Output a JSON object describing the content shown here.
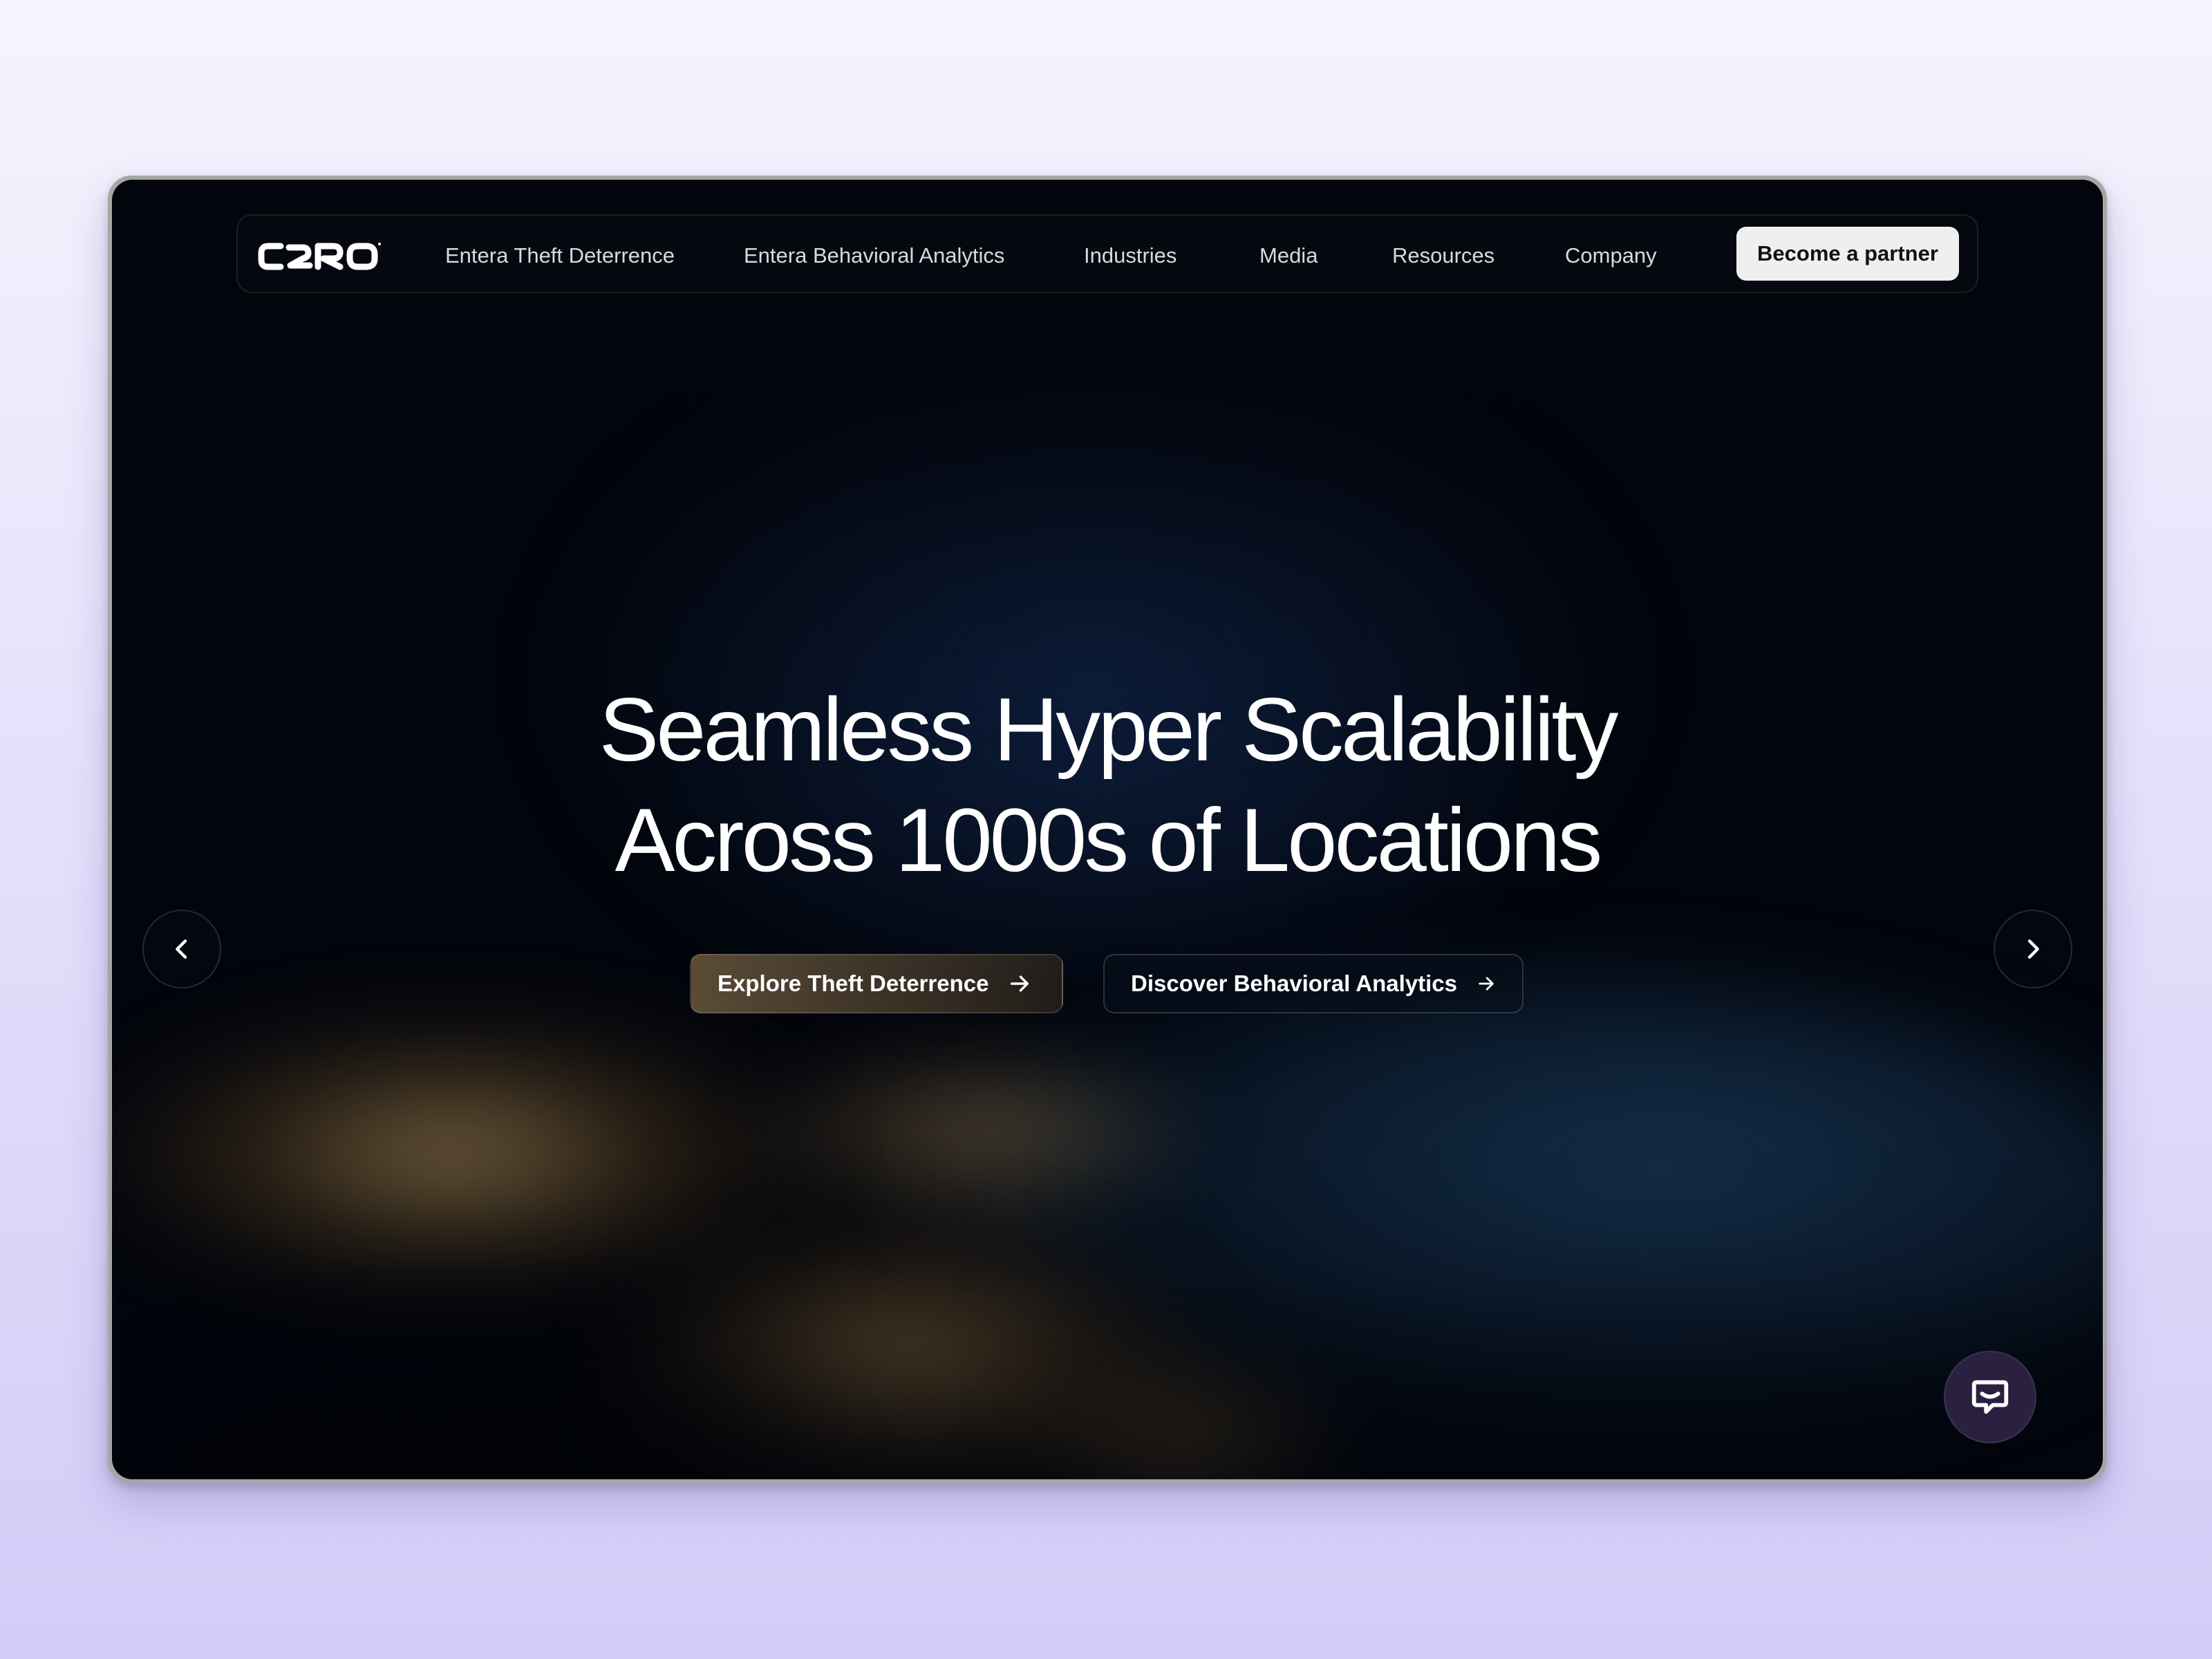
{
  "nav": {
    "logo_text": "C2RO",
    "links": [
      {
        "label": "Entera Theft Deterrence"
      },
      {
        "label": "Entera Behavioral Analytics"
      },
      {
        "label": "Industries"
      },
      {
        "label": "Media"
      },
      {
        "label": "Resources"
      },
      {
        "label": "Company"
      }
    ],
    "cta_label": "Become a partner"
  },
  "hero": {
    "headline_line1": "Seamless Hyper Scalability",
    "headline_line2": "Across 1000s of Locations",
    "buttons": [
      {
        "label": "Explore Theft Deterrence",
        "icon": "arrow-right-icon"
      },
      {
        "label": "Discover Behavioral Analytics",
        "icon": "arrow-right-icon"
      }
    ]
  },
  "carousel": {
    "prev_icon": "chevron-left-icon",
    "next_icon": "chevron-right-icon"
  },
  "chat": {
    "icon": "chat-bubble-icon"
  },
  "colors": {
    "page_background": "#e6e1fb",
    "screen_background": "#02050c",
    "partner_button": "#efefef",
    "chat_button": "#2a2140"
  }
}
